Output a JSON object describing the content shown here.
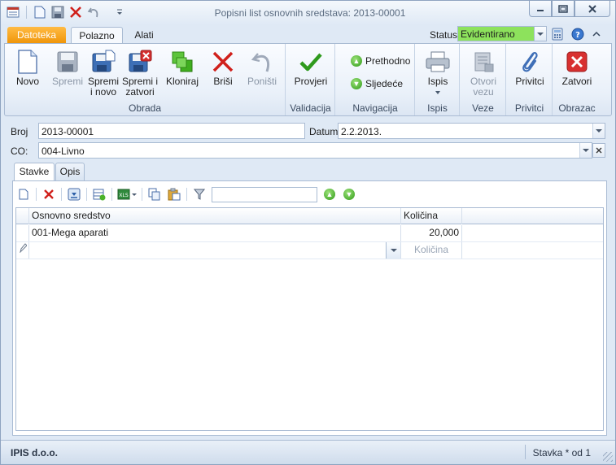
{
  "window": {
    "title": "Popisni list osnovnih sredstava: 2013-00001"
  },
  "tabs": {
    "file": "Datoteka",
    "home": "Polazno",
    "tools": "Alati"
  },
  "status": {
    "label": "Status",
    "value": "Evidentirano",
    "color": "#8de25c"
  },
  "ribbon": {
    "groups": {
      "obrada": "Obrada",
      "validacija": "Validacija",
      "navigacija": "Navigacija",
      "ispis": "Ispis",
      "veze": "Veze",
      "privitci": "Privitci",
      "obrazac": "Obrazac"
    },
    "buttons": {
      "novo": "Novo",
      "spremi": "Spremi",
      "spremi_i_novo_1": "Spremi",
      "spremi_i_novo_2": "i novo",
      "spremi_i_zatvori_1": "Spremi i",
      "spremi_i_zatvori_2": "zatvori",
      "kloniraj": "Kloniraj",
      "brisi": "Briši",
      "ponisti": "Poništi",
      "provjeri": "Provjeri",
      "prethodno": "Prethodno",
      "sljedece": "Sljedeće",
      "ispis": "Ispis",
      "otvori_vezu_1": "Otvori",
      "otvori_vezu_2": "vezu",
      "privitci": "Privitci",
      "zatvori": "Zatvori"
    }
  },
  "form": {
    "broj_label": "Broj",
    "broj_value": "2013-00001",
    "datum_label": "Datum",
    "datum_value": "2.2.2013.",
    "co_label": "CO:",
    "co_value": "004-Livno"
  },
  "content_tabs": {
    "stavke": "Stavke",
    "opis": "Opis"
  },
  "grid": {
    "columns": [
      "Osnovno sredstvo",
      "Količina"
    ],
    "rows": [
      {
        "osnovno_sredstvo": "001-Mega aparati",
        "kolicina": "20,000"
      }
    ],
    "new_row_placeholder": "Količina"
  },
  "statusbar": {
    "company": "IPIS d.o.o.",
    "record": "Stavka * od 1"
  }
}
